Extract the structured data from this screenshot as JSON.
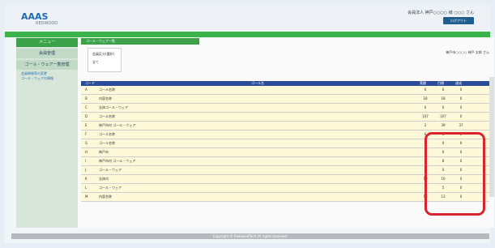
{
  "header": {
    "logo": "AAAS",
    "logo_sub": "REDWOOD",
    "user_info": "会員法人 神戸○○○○ 様 ○○○ さん",
    "logout": "ログアウト"
  },
  "sidebar": {
    "head": "メニュー",
    "items": [
      "会員管理",
      "ゴール・ウェア一覧管理"
    ],
    "links": [
      "会員情報等の変更",
      "ゴール・ウェアの情報"
    ]
  },
  "content": {
    "tab_label": "ゴール・ウェア一覧",
    "filter": {
      "label": "会員区分(選択)",
      "value": "全て"
    },
    "org_name": "神戸市○○○○ 神戸 太郎 さん",
    "columns": [
      "コード",
      "ゴール名",
      "実績",
      "目標",
      "達成"
    ],
    "rows": [
      {
        "code": "A",
        "name": "ゴール名称",
        "v1": "6",
        "v2": "6",
        "v3": "0"
      },
      {
        "code": "B",
        "name": "内容名称",
        "v1": "18",
        "v2": "18",
        "v3": "0"
      },
      {
        "code": "C",
        "name": "全体ゴール・ウェア",
        "v1": "6",
        "v2": "6",
        "v3": "0"
      },
      {
        "code": "D",
        "name": "ゴール名称",
        "v1": "107",
        "v2": "107",
        "v3": "0"
      },
      {
        "code": "E",
        "name": "神戸市内 ゴール・ウェア",
        "v1": "2",
        "v2": "39",
        "v3": "37"
      },
      {
        "code": "F",
        "name": "ゴール名称",
        "v1": "6",
        "v2": "6",
        "v3": "0"
      },
      {
        "code": "G",
        "name": "ゴール名称",
        "v1": "0",
        "v2": "0",
        "v3": "0"
      },
      {
        "code": "H",
        "name": "神戸市",
        "v1": "6",
        "v2": "6",
        "v3": "0"
      },
      {
        "code": "I",
        "name": "神戸市内 ゴール・ウェア",
        "v1": "8",
        "v2": "8",
        "v3": "0"
      },
      {
        "code": "J",
        "name": "ゴール・ウェア",
        "v1": "0",
        "v2": "0",
        "v3": "0"
      },
      {
        "code": "K",
        "name": "全体内",
        "v1": "10",
        "v2": "10",
        "v3": "0"
      },
      {
        "code": "L",
        "name": "ゴール・ウェア",
        "v1": "5",
        "v2": "5",
        "v3": "0"
      },
      {
        "code": "M",
        "name": "内容名称",
        "v1": "13",
        "v2": "13",
        "v3": "0"
      }
    ]
  },
  "footer": "Copyright © RedwoodTech All rights reserved."
}
